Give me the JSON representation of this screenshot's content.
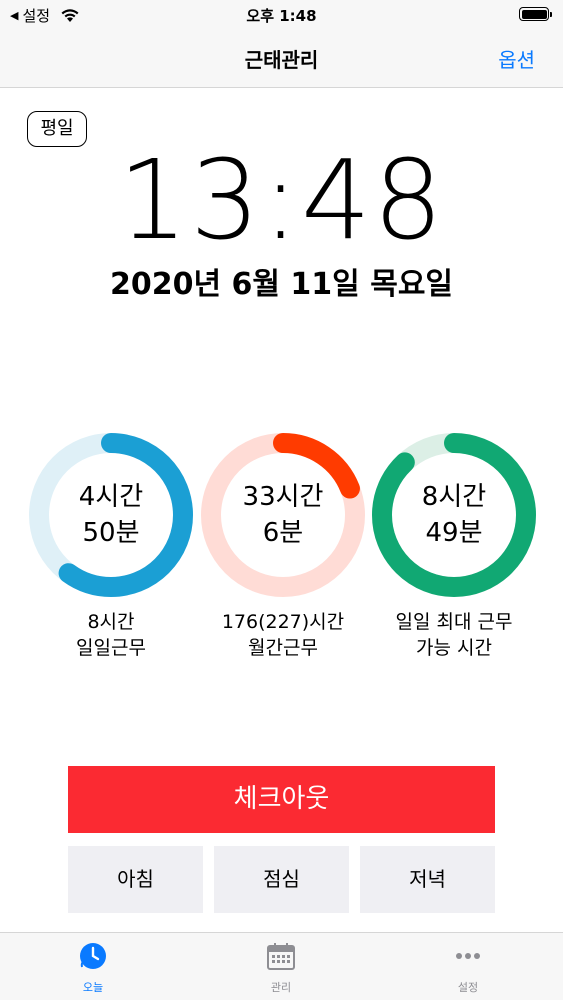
{
  "status": {
    "back_label": "설정",
    "time": "오후 1:48"
  },
  "nav": {
    "title": "근태관리",
    "option_label": "옵션"
  },
  "day_type": "평일",
  "clock": "13:48",
  "date": "2020년 6월 11일 목요일",
  "rings": [
    {
      "line1": "4시간",
      "line2": "50분",
      "caption1": "8시간",
      "caption2": "일일근무",
      "progress": 0.6,
      "color": "#1b9fd4",
      "track": "#dff0f7"
    },
    {
      "line1": "33시간",
      "line2": "6분",
      "caption1": "176(227)시간",
      "caption2": "월간근무",
      "progress": 0.19,
      "color": "#ff3b00",
      "track": "#ffdcd6"
    },
    {
      "line1": "8시간",
      "line2": "49분",
      "caption1": "일일 최대 근무",
      "caption2": "가능 시간",
      "progress": 0.88,
      "color": "#11a873",
      "track": "#dcefe6"
    }
  ],
  "checkout_label": "체크아웃",
  "meals": {
    "breakfast": "아침",
    "lunch": "점심",
    "dinner": "저녁"
  },
  "tabs": {
    "today": "오늘",
    "manage": "관리",
    "settings": "설정"
  },
  "colors": {
    "accent": "#0a7aff",
    "checkout": "#fb2a32"
  }
}
